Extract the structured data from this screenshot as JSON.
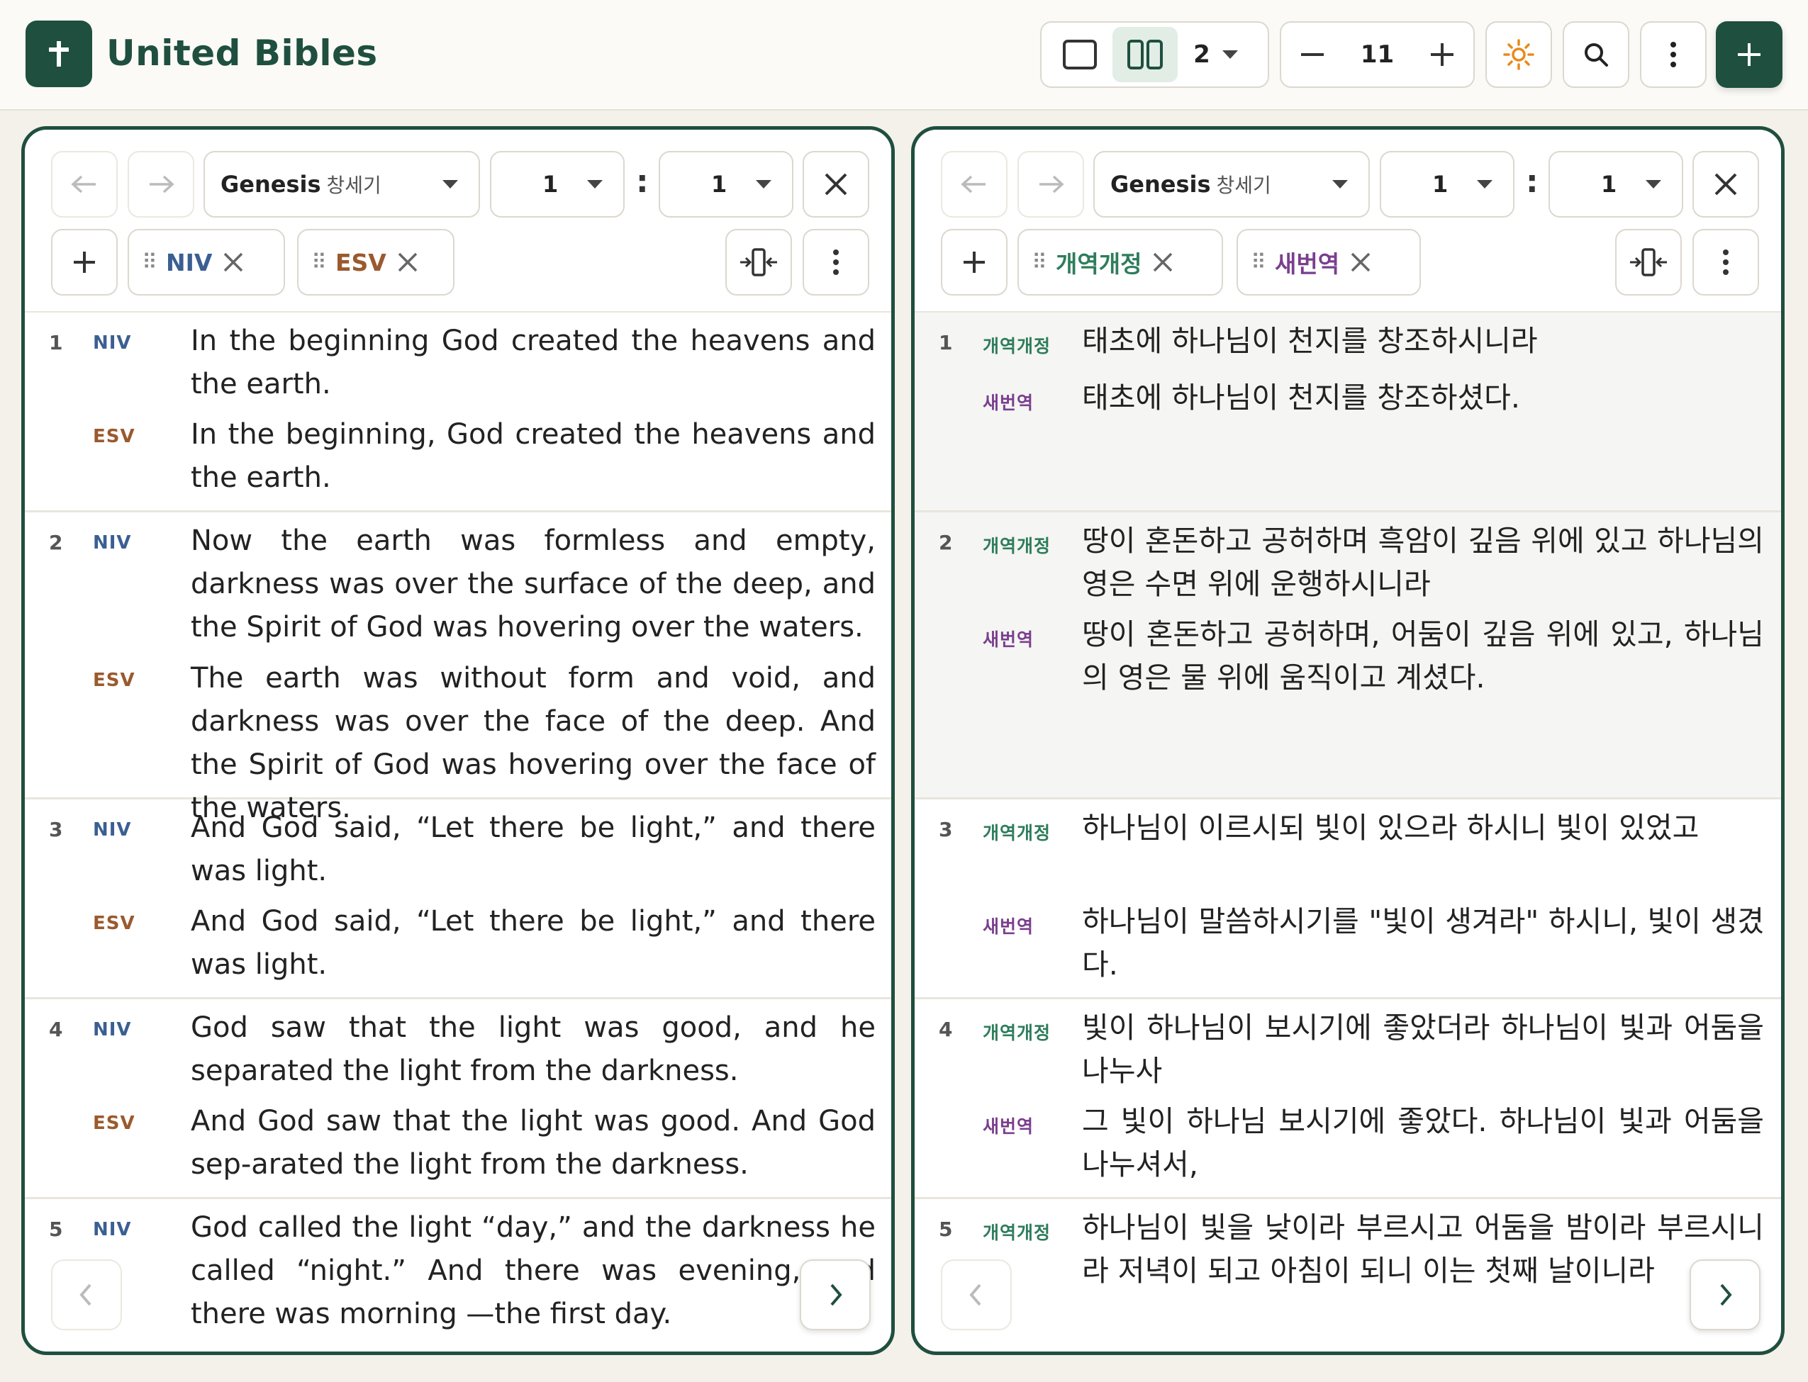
{
  "app": {
    "title": "United Bibles"
  },
  "header": {
    "column_count": "2",
    "font_size": "11"
  },
  "colors": {
    "brand": "#1f4f3f",
    "niv": "#3b5f92",
    "esv": "#9a5a2e",
    "krv": "#2e7d5b",
    "rnksv": "#7a3f8e",
    "sun": "#e88a1a"
  },
  "left_pane": {
    "book": "Genesis",
    "book_ko": "창세기",
    "chapter": "1",
    "verse": "1",
    "translations": [
      "NIV",
      "ESV"
    ],
    "verses": [
      {
        "num": "1",
        "lines": [
          {
            "label": "NIV",
            "text": "In the beginning God created the heavens and the earth."
          },
          {
            "label": "ESV",
            "text": "In the beginning, God created the heavens and the earth."
          }
        ]
      },
      {
        "num": "2",
        "lines": [
          {
            "label": "NIV",
            "text": "Now the earth was formless and empty, darkness was over the surface of the deep, and the Spirit of God was hovering over the waters."
          },
          {
            "label": "ESV",
            "text": "The earth was without form and void, and darkness was over the face of the deep. And the Spirit of God was hovering over the face of the waters."
          }
        ]
      },
      {
        "num": "3",
        "lines": [
          {
            "label": "NIV",
            "text": "And God said, “Let there be light,” and there was light."
          },
          {
            "label": "ESV",
            "text": "And God said, “Let there be light,” and there was light."
          }
        ]
      },
      {
        "num": "4",
        "lines": [
          {
            "label": "NIV",
            "text": "God saw that the light was good, and he separated the light from the darkness."
          },
          {
            "label": "ESV",
            "text": "And God saw that the light was good. And God sep-arated the light from the darkness."
          }
        ]
      },
      {
        "num": "5",
        "lines": [
          {
            "label": "NIV",
            "text": "God called the light “day,” and the darkness he called “night.” And there was evening, and there was morning —the first day."
          }
        ]
      }
    ]
  },
  "right_pane": {
    "book": "Genesis",
    "book_ko": "창세기",
    "chapter": "1",
    "verse": "1",
    "translations": [
      "개역개정",
      "새번역"
    ],
    "verses": [
      {
        "num": "1",
        "lines": [
          {
            "label": "개역개정",
            "text": "태초에 하나님이 천지를 창조하시니라"
          },
          {
            "label": "새번역",
            "text": "태초에 하나님이 천지를 창조하셨다."
          }
        ]
      },
      {
        "num": "2",
        "lines": [
          {
            "label": "개역개정",
            "text": "땅이 혼돈하고 공허하며 흑암이 깊음 위에 있고 하나님의 영은 수면 위에 운행하시니라"
          },
          {
            "label": "새번역",
            "text": "땅이 혼돈하고 공허하며, 어둠이 깊음 위에 있고, 하나님의 영은 물 위에 움직이고 계셨다."
          }
        ]
      },
      {
        "num": "3",
        "lines": [
          {
            "label": "개역개정",
            "text": "하나님이 이르시되 빛이 있으라 하시니 빛이 있었고"
          },
          {
            "label": "새번역",
            "text": "하나님이 말씀하시기를 \"빛이 생겨라\" 하시니, 빛이 생겼다."
          }
        ]
      },
      {
        "num": "4",
        "lines": [
          {
            "label": "개역개정",
            "text": "빛이 하나님이 보시기에 좋았더라 하나님이 빛과 어둠을 나누사"
          },
          {
            "label": "새번역",
            "text": "그 빛이 하나님 보시기에 좋았다. 하나님이 빛과 어둠을 나누셔서,"
          }
        ]
      },
      {
        "num": "5",
        "lines": [
          {
            "label": "개역개정",
            "text": "하나님이 빛을 낮이라 부르시고 어둠을 밤이라 부르시니라 저녁이 되고 아침이 되니 이는 첫째 날이니라"
          }
        ]
      }
    ]
  }
}
